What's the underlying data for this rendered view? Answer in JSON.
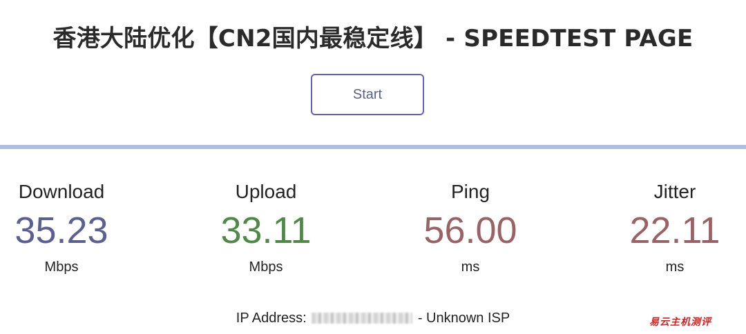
{
  "page": {
    "title": "香港大陆优化【CN2国内最稳定线】 - SPEEDTEST PAGE"
  },
  "controls": {
    "start_label": "Start"
  },
  "progress": {
    "fraction": 1.0
  },
  "meters": [
    {
      "label": "Download",
      "value": "35.23",
      "unit": "Mbps",
      "color": "#5c5f93"
    },
    {
      "label": "Upload",
      "value": "33.11",
      "unit": "Mbps",
      "color": "#4e8a45"
    },
    {
      "label": "Ping",
      "value": "56.00",
      "unit": "ms",
      "color": "#9a6265"
    },
    {
      "label": "Jitter",
      "value": "22.11",
      "unit": "ms",
      "color": "#9a6265"
    }
  ],
  "ip_info": {
    "prefix": "IP Address:",
    "separator": "-",
    "isp": "Unknown ISP"
  },
  "watermark": {
    "text": "易云主机测评"
  }
}
